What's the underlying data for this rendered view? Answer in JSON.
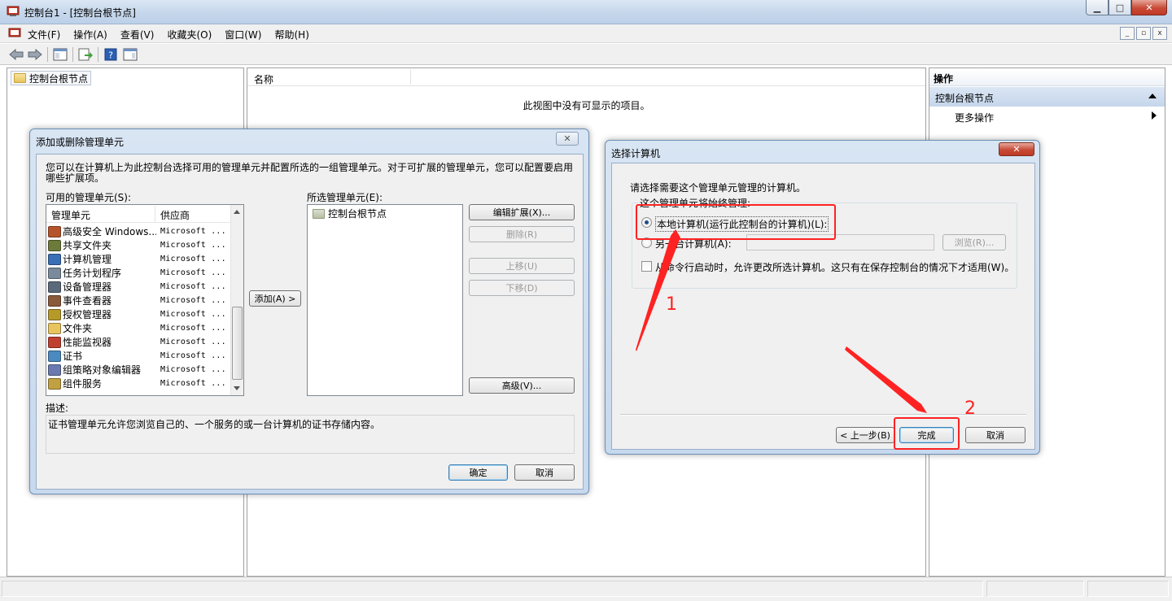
{
  "window": {
    "title": "控制台1 - [控制台根节点]",
    "caption": {
      "minimize": "▁",
      "maximize": "□",
      "close": "✕"
    }
  },
  "menu": {
    "items": [
      "文件(F)",
      "操作(A)",
      "查看(V)",
      "收藏夹(O)",
      "窗口(W)",
      "帮助(H)"
    ]
  },
  "tree": {
    "root_label": "控制台根节点"
  },
  "center": {
    "column_name": "名称",
    "empty_text": "此视图中没有可显示的项目。"
  },
  "actions": {
    "header": "操作",
    "selected": "控制台根节点",
    "more": "更多操作"
  },
  "snapin_dialog": {
    "title": "添加或删除管理单元",
    "close": "✕",
    "description_text": "您可以在计算机上为此控制台选择可用的管理单元并配置所选的一组管理单元。对于可扩展的管理单元，您可以配置要启用哪些扩展项。",
    "available_label": "可用的管理单元(S):",
    "col_snapin": "管理单元",
    "col_vendor": "供应商",
    "items": [
      {
        "name": "高级安全 Windows...",
        "vendor": "Microsoft ..."
      },
      {
        "name": "共享文件夹",
        "vendor": "Microsoft ..."
      },
      {
        "name": "计算机管理",
        "vendor": "Microsoft ..."
      },
      {
        "name": "任务计划程序",
        "vendor": "Microsoft ..."
      },
      {
        "name": "设备管理器",
        "vendor": "Microsoft ..."
      },
      {
        "name": "事件查看器",
        "vendor": "Microsoft ..."
      },
      {
        "name": "授权管理器",
        "vendor": "Microsoft ..."
      },
      {
        "name": "文件夹",
        "vendor": "Microsoft ..."
      },
      {
        "name": "性能监视器",
        "vendor": "Microsoft ..."
      },
      {
        "name": "证书",
        "vendor": "Microsoft ..."
      },
      {
        "name": "组策略对象编辑器",
        "vendor": "Microsoft ..."
      },
      {
        "name": "组件服务",
        "vendor": "Microsoft ..."
      }
    ],
    "add_button": "添加(A) >",
    "selected_label": "所选管理单元(E):",
    "selected_items": [
      "控制台根节点"
    ],
    "edit_ext_button": "编辑扩展(X)...",
    "remove_button": "删除(R)",
    "move_up_button": "上移(U)",
    "move_down_button": "下移(D)",
    "advanced_button": "高级(V)...",
    "desc_label": "描述:",
    "desc_value": "证书管理单元允许您浏览自己的、一个服务的或一台计算机的证书存储内容。",
    "ok_button": "确定",
    "cancel_button": "取消"
  },
  "select_computer": {
    "title": "选择计算机",
    "close": "✕",
    "prompt": "请选择需要这个管理单元管理的计算机。",
    "group_label": "这个管理单元将始终管理:",
    "local_option": "本地计算机(运行此控制台的计算机)(L):",
    "other_option": "另一台计算机(A):",
    "other_value": "",
    "browse_button": "浏览(R)...",
    "allow_change": "从命令行启动时，允许更改所选计算机。这只有在保存控制台的情况下才适用(W)。",
    "back_button": "< 上一步(B)",
    "finish_button": "完成",
    "cancel_button": "取消"
  },
  "annotations": {
    "step1": "1",
    "step2": "2",
    "color": "#ff2222"
  }
}
